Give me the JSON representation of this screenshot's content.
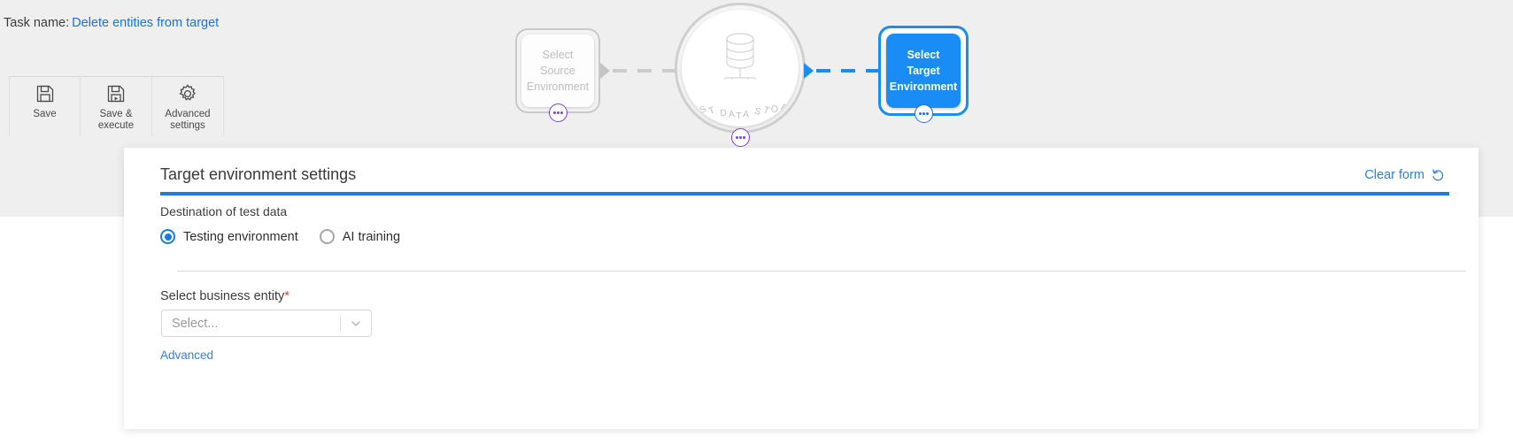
{
  "colors": {
    "accent_blue": "#1a7ee0",
    "node_blue": "#1a8cf5",
    "link_blue": "#2b7fe0",
    "required_red": "#e03c31",
    "badge_purple": "#7b3fe4",
    "page_gray": "#efefef",
    "disabled_gray": "#bdbdbd"
  },
  "task": {
    "label": "Task name:",
    "name": "Delete entities from target"
  },
  "toolbar": {
    "items": [
      {
        "label": "Save",
        "icon": "save-icon"
      },
      {
        "label": "Save &\nexecute",
        "icon": "save-execute-icon"
      },
      {
        "label": "Advanced\nsettings",
        "icon": "gear-icon"
      }
    ]
  },
  "flow": {
    "source_node": {
      "label": "Select\nSource\nEnvironment",
      "state": "disabled"
    },
    "store_node": {
      "caption": "TEST DATA STORE",
      "icon": "database-icon"
    },
    "target_node": {
      "label": "Select\nTarget\nEnvironment",
      "state": "selected"
    },
    "menu_badge_icon": "ellipsis-icon"
  },
  "panel": {
    "title": "Target environment settings",
    "clear_form": {
      "label": "Clear form",
      "icon": "undo-arrow-icon"
    },
    "destination": {
      "label": "Destination of test data",
      "options": [
        {
          "label": "Testing environment",
          "selected": true
        },
        {
          "label": "AI training",
          "selected": false
        }
      ]
    },
    "business_entity": {
      "label": "Select business entity",
      "required_marker": "*",
      "placeholder": "Select...",
      "caret_icon": "chevron-down-icon"
    },
    "advanced_link": "Advanced"
  }
}
